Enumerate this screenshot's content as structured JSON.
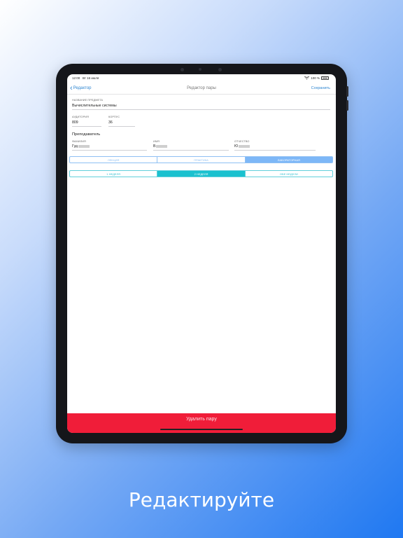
{
  "status_bar": {
    "time": "12:00",
    "date": "Вт 16 июля",
    "battery": "100 %"
  },
  "navbar": {
    "back_label": "Редактор",
    "title": "Редактор пары",
    "save_label": "Сохранить"
  },
  "subject": {
    "label": "НАЗВАНИЕ ПРЕДМЕТА",
    "value": "Вычислительные системы"
  },
  "room": {
    "label": "АУДИТОРИЯ",
    "value": "809"
  },
  "building": {
    "label": "КОРПУС",
    "value": "36"
  },
  "teacher": {
    "section_title": "Преподаватель",
    "surname": {
      "label": "ФАМИЛИЯ",
      "value": "Гуд"
    },
    "name": {
      "label": "ИМЯ",
      "value": "В"
    },
    "patronymic": {
      "label": "ОТЧЕСТВО",
      "value": "Ю"
    }
  },
  "lesson_type": {
    "options": [
      "ЛЕКЦИЯ",
      "ПРАКТИКА",
      "ЛАБОРАТОРНАЯ"
    ],
    "selected": "ЛАБОРАТОРНАЯ"
  },
  "week": {
    "options": [
      "1 НЕДЕЛЯ",
      "2 НЕДЕЛЯ",
      "ОБЕ НЕДЕЛИ"
    ],
    "selected": "2 НЕДЕЛЯ"
  },
  "delete_button": {
    "label": "Удалить пару",
    "color": "#f01d39"
  },
  "caption": "Редактируйте",
  "colors": {
    "accent": "#2e86d1",
    "segment_active": "#7db7f7",
    "week_active": "#1ac1cf"
  }
}
